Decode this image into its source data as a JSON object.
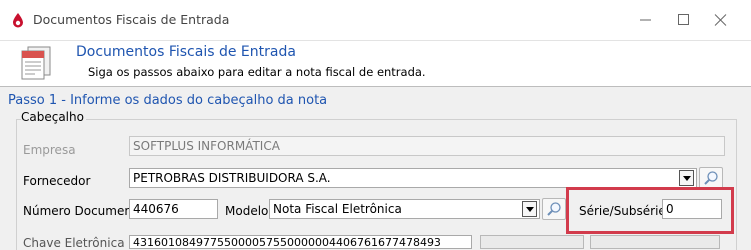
{
  "window": {
    "title": "Documentos Fiscais de Entrada",
    "icon": "red-drop-app-icon",
    "controls": [
      "minimize-icon",
      "maximize-icon",
      "close-icon"
    ]
  },
  "header": {
    "title": "Documentos Fiscais de Entrada",
    "subtitle": "Siga os passos abaixo para editar a nota fiscal de entrada.",
    "icon": "document-form-icon"
  },
  "step": {
    "label": "Passo 1 - Informe os dados do cabeçalho da nota"
  },
  "group": {
    "title": "Cabeçalho"
  },
  "form": {
    "empresa": {
      "label": "Empresa",
      "value": "SOFTPLUS INFORMÁTICA",
      "enabled": false
    },
    "fornecedor": {
      "label": "Fornecedor",
      "value": "PETROBRAS DISTRIBUIDORA S.A."
    },
    "numero_documento": {
      "label": "Número Documento",
      "value": "440676"
    },
    "modelo": {
      "label": "Modelo",
      "value": "Nota Fiscal Eletrônica"
    },
    "serie_subserie": {
      "label": "Série/Subsérie",
      "value": "0"
    },
    "chave_eletronica": {
      "label": "Chave Eletrônica",
      "value": "43160108497755000057550000004406761677478493"
    }
  },
  "colors": {
    "accent_blue": "#1f55b0",
    "highlight_red": "#d23b4c"
  }
}
